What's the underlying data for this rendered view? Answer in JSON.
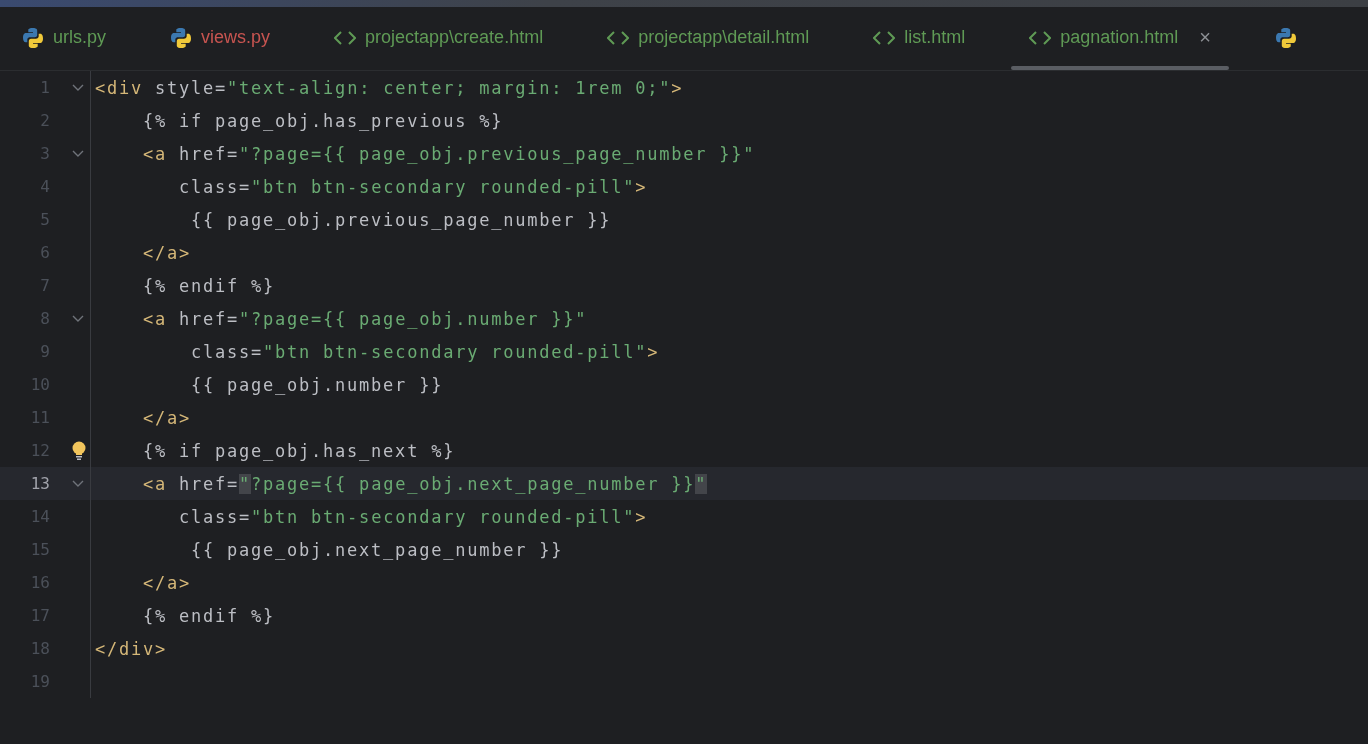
{
  "tabs": [
    {
      "kind": "python",
      "label": "urls.py",
      "color": "#5f9a55",
      "selected": false
    },
    {
      "kind": "python",
      "label": "views.py",
      "color": "#c75450",
      "selected": false
    },
    {
      "kind": "html",
      "label": "projectapp\\create.html",
      "color": "#5f9a55",
      "selected": false
    },
    {
      "kind": "html",
      "label": "projectapp\\detail.html",
      "color": "#5f9a55",
      "selected": false
    },
    {
      "kind": "html",
      "label": "list.html",
      "color": "#5f9a55",
      "selected": false
    },
    {
      "kind": "html",
      "label": "pagnation.html",
      "color": "#5f9a55",
      "selected": true,
      "close": "×"
    },
    {
      "kind": "python",
      "selected": false
    }
  ],
  "editor": {
    "lines": [
      {
        "number": "1",
        "fold": true,
        "tokens": [
          {
            "kind": "tag",
            "text": "<div"
          },
          {
            "kind": "plain",
            "text": " style="
          },
          {
            "kind": "string",
            "text": "\"text-align: center; margin: 1rem 0;\""
          },
          {
            "kind": "tag",
            "text": ">"
          }
        ]
      },
      {
        "number": "2",
        "tokens": [
          {
            "kind": "plain",
            "text": "    {% if page_obj.has_previous %}"
          }
        ]
      },
      {
        "number": "3",
        "fold": true,
        "tokens": [
          {
            "kind": "tag",
            "text": "    <a"
          },
          {
            "kind": "plain",
            "text": " href="
          },
          {
            "kind": "string",
            "text": "\"?page={{ page_obj.previous_page_number }}\""
          }
        ]
      },
      {
        "number": "4",
        "tokens": [
          {
            "kind": "plain",
            "text": "       class="
          },
          {
            "kind": "string",
            "text": "\"btn btn-secondary rounded-pill\""
          },
          {
            "kind": "tag",
            "text": ">"
          }
        ]
      },
      {
        "number": "5",
        "tokens": [
          {
            "kind": "plain",
            "text": "        {{ page_obj.previous_page_number }}"
          }
        ]
      },
      {
        "number": "6",
        "tokens": [
          {
            "kind": "tag",
            "text": "    </a>"
          }
        ]
      },
      {
        "number": "7",
        "tokens": [
          {
            "kind": "plain",
            "text": "    {% endif %}"
          }
        ]
      },
      {
        "number": "8",
        "fold": true,
        "tokens": [
          {
            "kind": "tag",
            "text": "    <a"
          },
          {
            "kind": "plain",
            "text": " href="
          },
          {
            "kind": "string",
            "text": "\"?page={{ page_obj.number }}\""
          }
        ]
      },
      {
        "number": "9",
        "tokens": [
          {
            "kind": "plain",
            "text": "        class="
          },
          {
            "kind": "string",
            "text": "\"btn btn-secondary rounded-pill\""
          },
          {
            "kind": "tag",
            "text": ">"
          }
        ]
      },
      {
        "number": "10",
        "tokens": [
          {
            "kind": "plain",
            "text": "        {{ page_obj.number }}"
          }
        ]
      },
      {
        "number": "11",
        "tokens": [
          {
            "kind": "tag",
            "text": "    </a>"
          }
        ]
      },
      {
        "number": "12",
        "bulb": true,
        "tokens": [
          {
            "kind": "plain",
            "text": "    {% if page_obj.has_next %}"
          }
        ]
      },
      {
        "number": "13",
        "fold": true,
        "current": true,
        "tokens": [
          {
            "kind": "tag",
            "text": "    <a"
          },
          {
            "kind": "plain",
            "text": " href="
          },
          {
            "kind": "match",
            "text": "\""
          },
          {
            "kind": "string",
            "text": "?page={{ page_obj.next_page_number }}"
          },
          {
            "kind": "match",
            "text": "\""
          }
        ]
      },
      {
        "number": "14",
        "tokens": [
          {
            "kind": "plain",
            "text": "       class="
          },
          {
            "kind": "string",
            "text": "\"btn btn-secondary rounded-pill\""
          },
          {
            "kind": "tag",
            "text": ">"
          }
        ]
      },
      {
        "number": "15",
        "tokens": [
          {
            "kind": "plain",
            "text": "        {{ page_obj.next_page_number }}"
          }
        ]
      },
      {
        "number": "16",
        "tokens": [
          {
            "kind": "tag",
            "text": "    </a>"
          }
        ]
      },
      {
        "number": "17",
        "tokens": [
          {
            "kind": "plain",
            "text": "    {% endif %}"
          }
        ]
      },
      {
        "number": "18",
        "tokens": [
          {
            "kind": "tag",
            "text": "</div>"
          }
        ]
      },
      {
        "number": "19"
      }
    ]
  }
}
